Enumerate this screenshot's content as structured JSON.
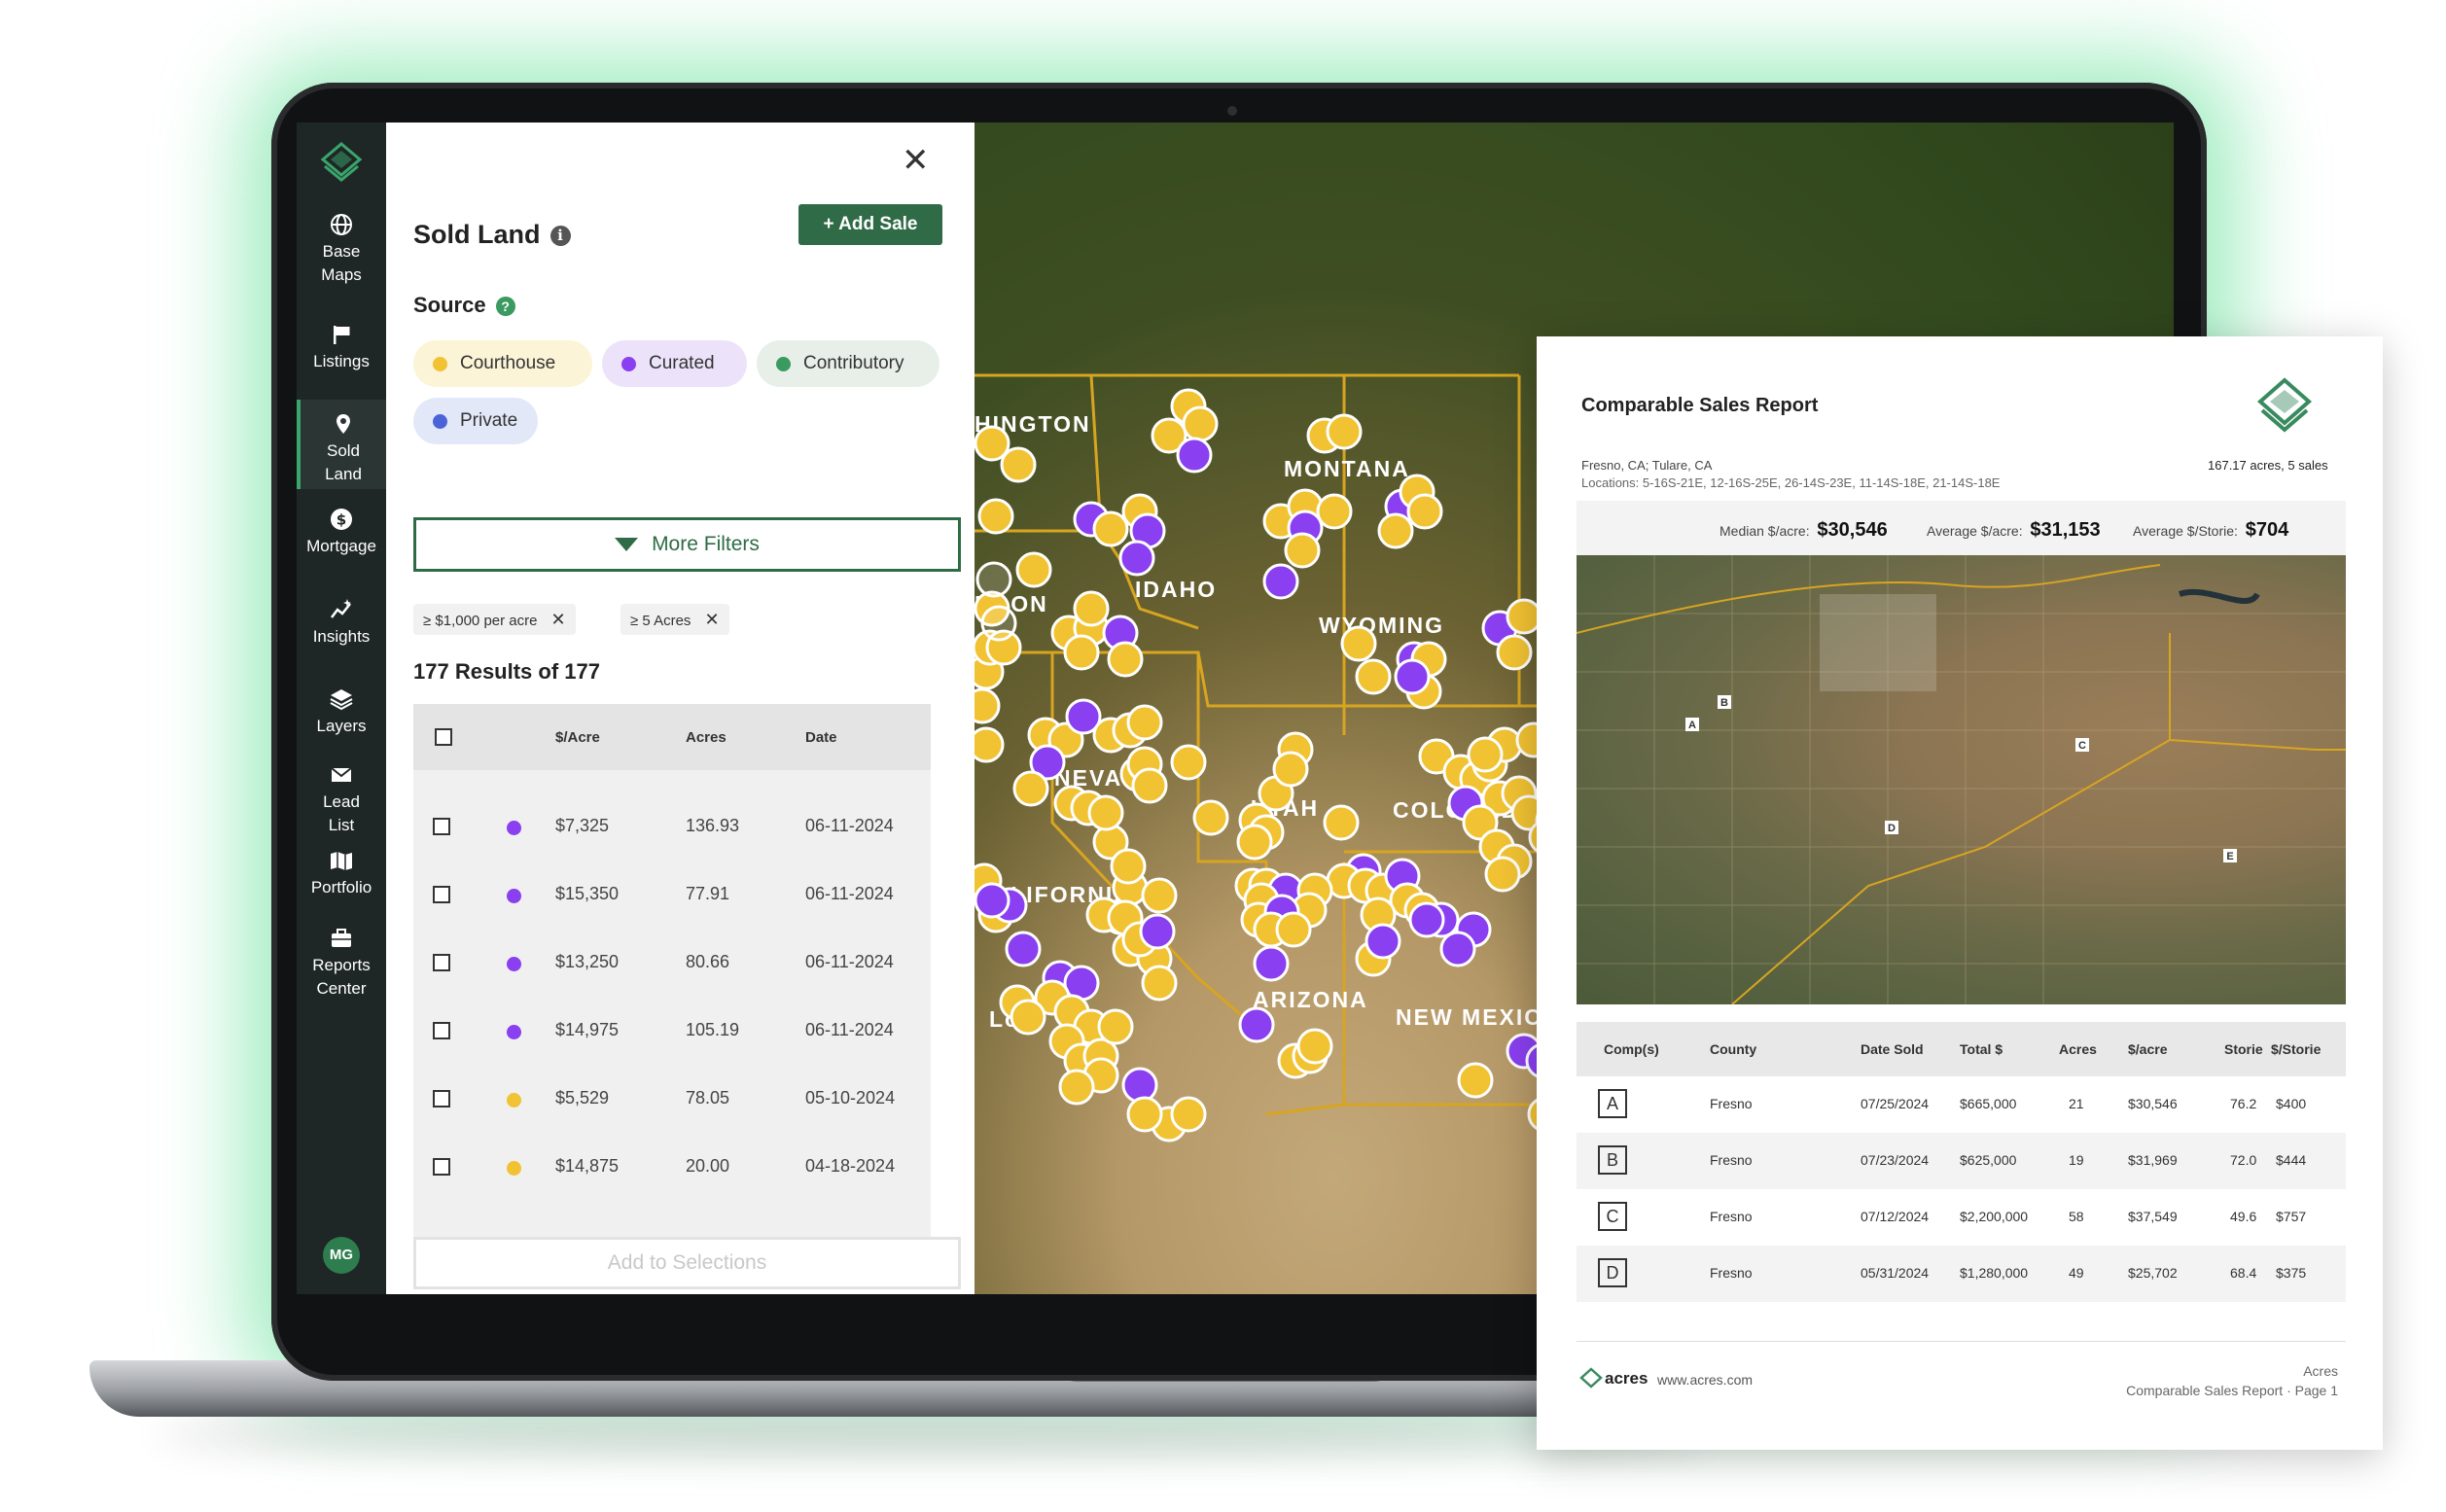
{
  "sidebar": {
    "items": [
      {
        "icon": "globe-icon",
        "label_line1": "Base",
        "label_line2": "Maps"
      },
      {
        "icon": "flag-icon",
        "label_line1": "Listings",
        "label_line2": ""
      },
      {
        "icon": "map-pin-icon",
        "label_line1": "Sold",
        "label_line2": "Land"
      },
      {
        "icon": "dollar-circle-icon",
        "label_line1": "Mortgage",
        "label_line2": ""
      },
      {
        "icon": "sparkle-chart-icon",
        "label_line1": "Insights",
        "label_line2": ""
      },
      {
        "icon": "layers-icon",
        "label_line1": "Layers",
        "label_line2": ""
      },
      {
        "icon": "envelope-icon",
        "label_line1": "Lead",
        "label_line2": "List"
      },
      {
        "icon": "folded-map-icon",
        "label_line1": "Portfolio",
        "label_line2": ""
      },
      {
        "icon": "briefcase-icon",
        "label_line1": "Reports",
        "label_line2": "Center"
      }
    ],
    "active": "Sold Land",
    "avatar_initials": "MG"
  },
  "panel": {
    "title": "Sold Land",
    "info_glyph": "i",
    "add_sale_label": "+  Add Sale",
    "close_glyph": "✕",
    "source_label": "Source",
    "help_glyph": "?",
    "chips": [
      {
        "label": "Courthouse",
        "dot_color": "#f1c232",
        "bg": "#fbf4d6"
      },
      {
        "label": "Curated",
        "dot_color": "#8a3ff0",
        "bg": "#ece3fb"
      },
      {
        "label": "Contributory",
        "dot_color": "#3a9a5f",
        "bg": "#e8efe8"
      },
      {
        "label": "Private",
        "dot_color": "#4a63d8",
        "bg": "#e3e8f8"
      }
    ],
    "more_filters_label": "More Filters",
    "active_filters": [
      "≥ $1,000 per acre",
      "≥ 5 Acres"
    ],
    "remove_glyph": "✕",
    "results_label": "177 Results of 177",
    "table": {
      "headers": [
        "$/Acre",
        "Acres",
        "Date"
      ],
      "rows": [
        {
          "color": "#8a3ff0",
          "price": "$7,325",
          "acres": "136.93",
          "date": "06-11-2024"
        },
        {
          "color": "#8a3ff0",
          "price": "$15,350",
          "acres": "77.91",
          "date": "06-11-2024"
        },
        {
          "color": "#8a3ff0",
          "price": "$13,250",
          "acres": "80.66",
          "date": "06-11-2024"
        },
        {
          "color": "#8a3ff0",
          "price": "$14,975",
          "acres": "105.19",
          "date": "06-11-2024"
        },
        {
          "color": "#f1c232",
          "price": "$5,529",
          "acres": "78.05",
          "date": "05-10-2024"
        },
        {
          "color": "#f1c232",
          "price": "$14,875",
          "acres": "20.00",
          "date": "04-18-2024"
        }
      ]
    },
    "add_to_selections_label": "Add to Selections"
  },
  "map": {
    "labels": [
      "HINGTON",
      "MONTANA",
      "IDAHO",
      "EGON",
      "WYOMING",
      "NEVADA",
      "UTAH",
      "COLORADO",
      "CALIFORNIA",
      "ARIZONA",
      "NEW MEXICO",
      "Los"
    ],
    "marker_colors": {
      "courthouse": "#f1c232",
      "curated": "#8a3ff0"
    }
  },
  "report": {
    "title": "Comparable Sales Report",
    "place": "Fresno, CA; Tulare, CA",
    "locations": "Locations: 5-16S-21E, 12-16S-25E, 26-14S-23E, 11-14S-18E, 21-14S-18E",
    "summary": "167.17 acres, 5 sales",
    "median_label": "Median $/acre:",
    "median_value": "$30,546",
    "average_label": "Average $/acre:",
    "average_value": "$31,153",
    "storie_label": "Average $/Storie:",
    "storie_value": "$704",
    "map_markers": [
      "A",
      "B",
      "C",
      "D",
      "E"
    ],
    "table": {
      "headers": [
        "Comp(s)",
        "County",
        "Date Sold",
        "Total $",
        "Acres",
        "$/acre",
        "Storie",
        "$/Storie"
      ],
      "rows": [
        {
          "comp": "A",
          "county": "Fresno",
          "date": "07/25/2024",
          "total": "$665,000",
          "acres": "21",
          "per_acre": "$30,546",
          "storie": "76.2",
          "per_storie": "$400"
        },
        {
          "comp": "B",
          "county": "Fresno",
          "date": "07/23/2024",
          "total": "$625,000",
          "acres": "19",
          "per_acre": "$31,969",
          "storie": "72.0",
          "per_storie": "$444"
        },
        {
          "comp": "C",
          "county": "Fresno",
          "date": "07/12/2024",
          "total": "$2,200,000",
          "acres": "58",
          "per_acre": "$37,549",
          "storie": "49.6",
          "per_storie": "$757"
        },
        {
          "comp": "D",
          "county": "Fresno",
          "date": "05/31/2024",
          "total": "$1,280,000",
          "acres": "49",
          "per_acre": "$25,702",
          "storie": "68.4",
          "per_storie": "$375"
        }
      ]
    },
    "footer": {
      "brand": "acres",
      "site": "www.acres.com",
      "right_line1": "Acres",
      "right_line2": "Comparable Sales Report  ·  Page 1"
    }
  }
}
